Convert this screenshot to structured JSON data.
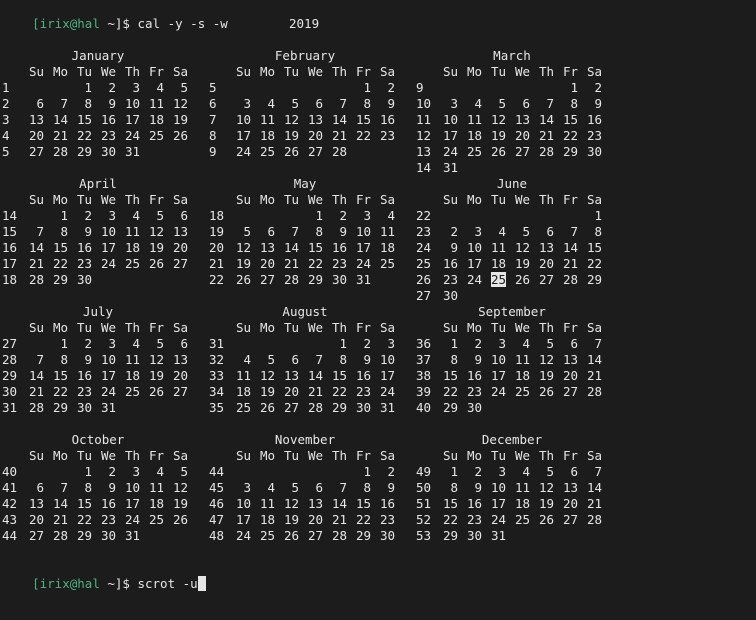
{
  "terminal": {
    "prompt1": {
      "user": "[irix@hal",
      "dir": " ~]$ ",
      "command": "cal -y -s -w"
    },
    "year": "2019",
    "prompt2": {
      "user": "[irix@hal",
      "dir": " ~]$ ",
      "command": "scrot -u"
    }
  },
  "weekday_headers": [
    "Su",
    "Mo",
    "Tu",
    "We",
    "Th",
    "Fr",
    "Sa"
  ],
  "today": {
    "month": 5,
    "day": "25"
  },
  "months": [
    {
      "name": "January",
      "weeks": [
        [
          "1",
          "",
          "",
          "1",
          "2",
          "3",
          "4",
          "5"
        ],
        [
          "2",
          "6",
          "7",
          "8",
          "9",
          "10",
          "11",
          "12"
        ],
        [
          "3",
          "13",
          "14",
          "15",
          "16",
          "17",
          "18",
          "19"
        ],
        [
          "4",
          "20",
          "21",
          "22",
          "23",
          "24",
          "25",
          "26"
        ],
        [
          "5",
          "27",
          "28",
          "29",
          "30",
          "31",
          "",
          ""
        ]
      ]
    },
    {
      "name": "February",
      "weeks": [
        [
          "5",
          "",
          "",
          "",
          "",
          "",
          "1",
          "2"
        ],
        [
          "6",
          "3",
          "4",
          "5",
          "6",
          "7",
          "8",
          "9"
        ],
        [
          "7",
          "10",
          "11",
          "12",
          "13",
          "14",
          "15",
          "16"
        ],
        [
          "8",
          "17",
          "18",
          "19",
          "20",
          "21",
          "22",
          "23"
        ],
        [
          "9",
          "24",
          "25",
          "26",
          "27",
          "28",
          "",
          ""
        ]
      ]
    },
    {
      "name": "March",
      "weeks": [
        [
          "9",
          "",
          "",
          "",
          "",
          "",
          "1",
          "2"
        ],
        [
          "10",
          "3",
          "4",
          "5",
          "6",
          "7",
          "8",
          "9"
        ],
        [
          "11",
          "10",
          "11",
          "12",
          "13",
          "14",
          "15",
          "16"
        ],
        [
          "12",
          "17",
          "18",
          "19",
          "20",
          "21",
          "22",
          "23"
        ],
        [
          "13",
          "24",
          "25",
          "26",
          "27",
          "28",
          "29",
          "30"
        ],
        [
          "14",
          "31",
          "",
          "",
          "",
          "",
          "",
          ""
        ]
      ]
    },
    {
      "name": "April",
      "weeks": [
        [
          "14",
          "",
          "1",
          "2",
          "3",
          "4",
          "5",
          "6"
        ],
        [
          "15",
          "7",
          "8",
          "9",
          "10",
          "11",
          "12",
          "13"
        ],
        [
          "16",
          "14",
          "15",
          "16",
          "17",
          "18",
          "19",
          "20"
        ],
        [
          "17",
          "21",
          "22",
          "23",
          "24",
          "25",
          "26",
          "27"
        ],
        [
          "18",
          "28",
          "29",
          "30",
          "",
          "",
          "",
          ""
        ]
      ]
    },
    {
      "name": "May",
      "weeks": [
        [
          "18",
          "",
          "",
          "",
          "1",
          "2",
          "3",
          "4"
        ],
        [
          "19",
          "5",
          "6",
          "7",
          "8",
          "9",
          "10",
          "11"
        ],
        [
          "20",
          "12",
          "13",
          "14",
          "15",
          "16",
          "17",
          "18"
        ],
        [
          "21",
          "19",
          "20",
          "21",
          "22",
          "23",
          "24",
          "25"
        ],
        [
          "22",
          "26",
          "27",
          "28",
          "29",
          "30",
          "31",
          ""
        ]
      ]
    },
    {
      "name": "June",
      "weeks": [
        [
          "22",
          "",
          "",
          "",
          "",
          "",
          "",
          "1"
        ],
        [
          "23",
          "2",
          "3",
          "4",
          "5",
          "6",
          "7",
          "8"
        ],
        [
          "24",
          "9",
          "10",
          "11",
          "12",
          "13",
          "14",
          "15"
        ],
        [
          "25",
          "16",
          "17",
          "18",
          "19",
          "20",
          "21",
          "22"
        ],
        [
          "26",
          "23",
          "24",
          "25",
          "26",
          "27",
          "28",
          "29"
        ],
        [
          "27",
          "30",
          "",
          "",
          "",
          "",
          "",
          ""
        ]
      ]
    },
    {
      "name": "July",
      "weeks": [
        [
          "27",
          "",
          "1",
          "2",
          "3",
          "4",
          "5",
          "6"
        ],
        [
          "28",
          "7",
          "8",
          "9",
          "10",
          "11",
          "12",
          "13"
        ],
        [
          "29",
          "14",
          "15",
          "16",
          "17",
          "18",
          "19",
          "20"
        ],
        [
          "30",
          "21",
          "22",
          "23",
          "24",
          "25",
          "26",
          "27"
        ],
        [
          "31",
          "28",
          "29",
          "30",
          "31",
          "",
          "",
          ""
        ]
      ]
    },
    {
      "name": "August",
      "weeks": [
        [
          "31",
          "",
          "",
          "",
          "",
          "1",
          "2",
          "3"
        ],
        [
          "32",
          "4",
          "5",
          "6",
          "7",
          "8",
          "9",
          "10"
        ],
        [
          "33",
          "11",
          "12",
          "13",
          "14",
          "15",
          "16",
          "17"
        ],
        [
          "34",
          "18",
          "19",
          "20",
          "21",
          "22",
          "23",
          "24"
        ],
        [
          "35",
          "25",
          "26",
          "27",
          "28",
          "29",
          "30",
          "31"
        ]
      ]
    },
    {
      "name": "September",
      "weeks": [
        [
          "36",
          "1",
          "2",
          "3",
          "4",
          "5",
          "6",
          "7"
        ],
        [
          "37",
          "8",
          "9",
          "10",
          "11",
          "12",
          "13",
          "14"
        ],
        [
          "38",
          "15",
          "16",
          "17",
          "18",
          "19",
          "20",
          "21"
        ],
        [
          "39",
          "22",
          "23",
          "24",
          "25",
          "26",
          "27",
          "28"
        ],
        [
          "40",
          "29",
          "30",
          "",
          "",
          "",
          "",
          ""
        ]
      ]
    },
    {
      "name": "October",
      "weeks": [
        [
          "40",
          "",
          "",
          "1",
          "2",
          "3",
          "4",
          "5"
        ],
        [
          "41",
          "6",
          "7",
          "8",
          "9",
          "10",
          "11",
          "12"
        ],
        [
          "42",
          "13",
          "14",
          "15",
          "16",
          "17",
          "18",
          "19"
        ],
        [
          "43",
          "20",
          "21",
          "22",
          "23",
          "24",
          "25",
          "26"
        ],
        [
          "44",
          "27",
          "28",
          "29",
          "30",
          "31",
          "",
          ""
        ]
      ]
    },
    {
      "name": "November",
      "weeks": [
        [
          "44",
          "",
          "",
          "",
          "",
          "",
          "1",
          "2"
        ],
        [
          "45",
          "3",
          "4",
          "5",
          "6",
          "7",
          "8",
          "9"
        ],
        [
          "46",
          "10",
          "11",
          "12",
          "13",
          "14",
          "15",
          "16"
        ],
        [
          "47",
          "17",
          "18",
          "19",
          "20",
          "21",
          "22",
          "23"
        ],
        [
          "48",
          "24",
          "25",
          "26",
          "27",
          "28",
          "29",
          "30"
        ]
      ]
    },
    {
      "name": "December",
      "weeks": [
        [
          "49",
          "1",
          "2",
          "3",
          "4",
          "5",
          "6",
          "7"
        ],
        [
          "50",
          "8",
          "9",
          "10",
          "11",
          "12",
          "13",
          "14"
        ],
        [
          "51",
          "15",
          "16",
          "17",
          "18",
          "19",
          "20",
          "21"
        ],
        [
          "52",
          "22",
          "23",
          "24",
          "25",
          "26",
          "27",
          "28"
        ],
        [
          "53",
          "29",
          "30",
          "31",
          "",
          "",
          "",
          ""
        ]
      ]
    }
  ]
}
